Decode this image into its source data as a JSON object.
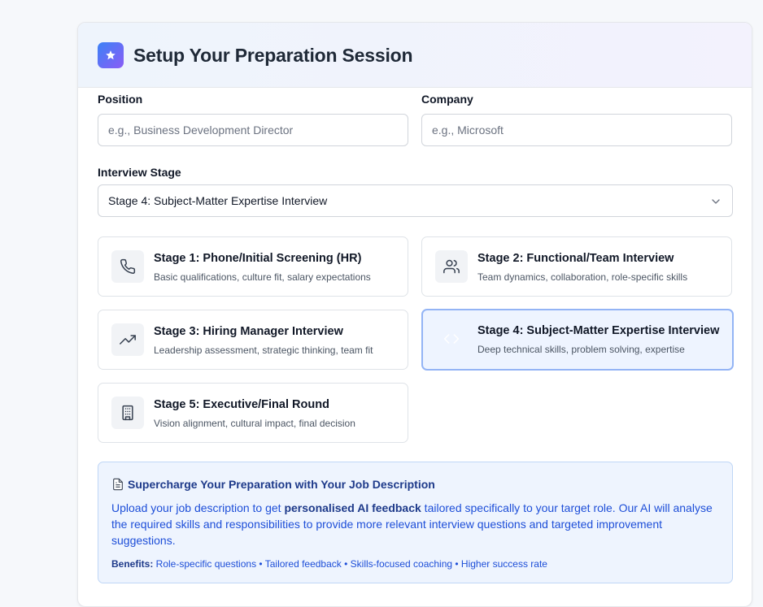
{
  "header": {
    "title": "Setup Your Preparation Session",
    "icon": "sparkle-icon"
  },
  "form": {
    "position": {
      "label": "Position",
      "placeholder": "e.g., Business Development Director",
      "value": ""
    },
    "company": {
      "label": "Company",
      "placeholder": "e.g., Microsoft",
      "value": ""
    },
    "interview_stage": {
      "label": "Interview Stage",
      "selected": "Stage 4: Subject-Matter Expertise Interview"
    }
  },
  "stages": [
    {
      "title": "Stage 1: Phone/Initial Screening (HR)",
      "desc": "Basic qualifications, culture fit, salary expectations",
      "icon": "phone-icon",
      "selected": false
    },
    {
      "title": "Stage 2: Functional/Team Interview",
      "desc": "Team dynamics, collaboration, role-specific skills",
      "icon": "users-icon",
      "selected": false
    },
    {
      "title": "Stage 3: Hiring Manager Interview",
      "desc": "Leadership assessment, strategic thinking, team fit",
      "icon": "trending-up-icon",
      "selected": false
    },
    {
      "title": "Stage 4: Subject-Matter Expertise Interview",
      "desc": "Deep technical skills, problem solving, expertise",
      "icon": "code-icon",
      "selected": true
    },
    {
      "title": "Stage 5: Executive/Final Round",
      "desc": "Vision alignment, cultural impact, final decision",
      "icon": "building-icon",
      "selected": false
    }
  ],
  "info": {
    "title": "Supercharge Your Preparation with Your Job Description",
    "body_prefix": "Upload your job description to get ",
    "body_bold": "personalised AI feedback",
    "body_suffix": " tailored specifically to your target role. Our AI will analyse the required skills and responsibilities to provide more relevant interview questions and targeted improvement suggestions.",
    "benefits_label": "Benefits:",
    "benefits_text": " Role-specific questions • Tailored feedback • Skills-focused coaching • Higher success rate"
  },
  "colors": {
    "accent_blue": "#1d4ed8",
    "selected_border": "#93b4f5",
    "selected_bg": "#eef4ff",
    "info_bg": "#eef4fe"
  }
}
